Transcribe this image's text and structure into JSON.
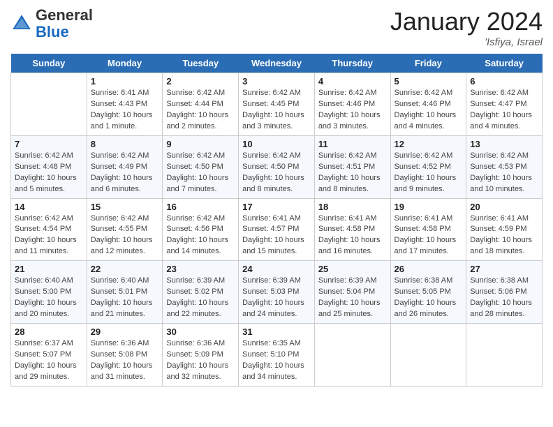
{
  "header": {
    "logo_general": "General",
    "logo_blue": "Blue",
    "month_title": "January 2024",
    "location": "'Isfiya, Israel"
  },
  "days_of_week": [
    "Sunday",
    "Monday",
    "Tuesday",
    "Wednesday",
    "Thursday",
    "Friday",
    "Saturday"
  ],
  "weeks": [
    [
      {
        "date": "",
        "sunrise": "",
        "sunset": "",
        "daylight": ""
      },
      {
        "date": "1",
        "sunrise": "Sunrise: 6:41 AM",
        "sunset": "Sunset: 4:43 PM",
        "daylight": "Daylight: 10 hours and 1 minute."
      },
      {
        "date": "2",
        "sunrise": "Sunrise: 6:42 AM",
        "sunset": "Sunset: 4:44 PM",
        "daylight": "Daylight: 10 hours and 2 minutes."
      },
      {
        "date": "3",
        "sunrise": "Sunrise: 6:42 AM",
        "sunset": "Sunset: 4:45 PM",
        "daylight": "Daylight: 10 hours and 3 minutes."
      },
      {
        "date": "4",
        "sunrise": "Sunrise: 6:42 AM",
        "sunset": "Sunset: 4:46 PM",
        "daylight": "Daylight: 10 hours and 3 minutes."
      },
      {
        "date": "5",
        "sunrise": "Sunrise: 6:42 AM",
        "sunset": "Sunset: 4:46 PM",
        "daylight": "Daylight: 10 hours and 4 minutes."
      },
      {
        "date": "6",
        "sunrise": "Sunrise: 6:42 AM",
        "sunset": "Sunset: 4:47 PM",
        "daylight": "Daylight: 10 hours and 4 minutes."
      }
    ],
    [
      {
        "date": "7",
        "sunrise": "Sunrise: 6:42 AM",
        "sunset": "Sunset: 4:48 PM",
        "daylight": "Daylight: 10 hours and 5 minutes."
      },
      {
        "date": "8",
        "sunrise": "Sunrise: 6:42 AM",
        "sunset": "Sunset: 4:49 PM",
        "daylight": "Daylight: 10 hours and 6 minutes."
      },
      {
        "date": "9",
        "sunrise": "Sunrise: 6:42 AM",
        "sunset": "Sunset: 4:50 PM",
        "daylight": "Daylight: 10 hours and 7 minutes."
      },
      {
        "date": "10",
        "sunrise": "Sunrise: 6:42 AM",
        "sunset": "Sunset: 4:50 PM",
        "daylight": "Daylight: 10 hours and 8 minutes."
      },
      {
        "date": "11",
        "sunrise": "Sunrise: 6:42 AM",
        "sunset": "Sunset: 4:51 PM",
        "daylight": "Daylight: 10 hours and 8 minutes."
      },
      {
        "date": "12",
        "sunrise": "Sunrise: 6:42 AM",
        "sunset": "Sunset: 4:52 PM",
        "daylight": "Daylight: 10 hours and 9 minutes."
      },
      {
        "date": "13",
        "sunrise": "Sunrise: 6:42 AM",
        "sunset": "Sunset: 4:53 PM",
        "daylight": "Daylight: 10 hours and 10 minutes."
      }
    ],
    [
      {
        "date": "14",
        "sunrise": "Sunrise: 6:42 AM",
        "sunset": "Sunset: 4:54 PM",
        "daylight": "Daylight: 10 hours and 11 minutes."
      },
      {
        "date": "15",
        "sunrise": "Sunrise: 6:42 AM",
        "sunset": "Sunset: 4:55 PM",
        "daylight": "Daylight: 10 hours and 12 minutes."
      },
      {
        "date": "16",
        "sunrise": "Sunrise: 6:42 AM",
        "sunset": "Sunset: 4:56 PM",
        "daylight": "Daylight: 10 hours and 14 minutes."
      },
      {
        "date": "17",
        "sunrise": "Sunrise: 6:41 AM",
        "sunset": "Sunset: 4:57 PM",
        "daylight": "Daylight: 10 hours and 15 minutes."
      },
      {
        "date": "18",
        "sunrise": "Sunrise: 6:41 AM",
        "sunset": "Sunset: 4:58 PM",
        "daylight": "Daylight: 10 hours and 16 minutes."
      },
      {
        "date": "19",
        "sunrise": "Sunrise: 6:41 AM",
        "sunset": "Sunset: 4:58 PM",
        "daylight": "Daylight: 10 hours and 17 minutes."
      },
      {
        "date": "20",
        "sunrise": "Sunrise: 6:41 AM",
        "sunset": "Sunset: 4:59 PM",
        "daylight": "Daylight: 10 hours and 18 minutes."
      }
    ],
    [
      {
        "date": "21",
        "sunrise": "Sunrise: 6:40 AM",
        "sunset": "Sunset: 5:00 PM",
        "daylight": "Daylight: 10 hours and 20 minutes."
      },
      {
        "date": "22",
        "sunrise": "Sunrise: 6:40 AM",
        "sunset": "Sunset: 5:01 PM",
        "daylight": "Daylight: 10 hours and 21 minutes."
      },
      {
        "date": "23",
        "sunrise": "Sunrise: 6:39 AM",
        "sunset": "Sunset: 5:02 PM",
        "daylight": "Daylight: 10 hours and 22 minutes."
      },
      {
        "date": "24",
        "sunrise": "Sunrise: 6:39 AM",
        "sunset": "Sunset: 5:03 PM",
        "daylight": "Daylight: 10 hours and 24 minutes."
      },
      {
        "date": "25",
        "sunrise": "Sunrise: 6:39 AM",
        "sunset": "Sunset: 5:04 PM",
        "daylight": "Daylight: 10 hours and 25 minutes."
      },
      {
        "date": "26",
        "sunrise": "Sunrise: 6:38 AM",
        "sunset": "Sunset: 5:05 PM",
        "daylight": "Daylight: 10 hours and 26 minutes."
      },
      {
        "date": "27",
        "sunrise": "Sunrise: 6:38 AM",
        "sunset": "Sunset: 5:06 PM",
        "daylight": "Daylight: 10 hours and 28 minutes."
      }
    ],
    [
      {
        "date": "28",
        "sunrise": "Sunrise: 6:37 AM",
        "sunset": "Sunset: 5:07 PM",
        "daylight": "Daylight: 10 hours and 29 minutes."
      },
      {
        "date": "29",
        "sunrise": "Sunrise: 6:36 AM",
        "sunset": "Sunset: 5:08 PM",
        "daylight": "Daylight: 10 hours and 31 minutes."
      },
      {
        "date": "30",
        "sunrise": "Sunrise: 6:36 AM",
        "sunset": "Sunset: 5:09 PM",
        "daylight": "Daylight: 10 hours and 32 minutes."
      },
      {
        "date": "31",
        "sunrise": "Sunrise: 6:35 AM",
        "sunset": "Sunset: 5:10 PM",
        "daylight": "Daylight: 10 hours and 34 minutes."
      },
      {
        "date": "",
        "sunrise": "",
        "sunset": "",
        "daylight": ""
      },
      {
        "date": "",
        "sunrise": "",
        "sunset": "",
        "daylight": ""
      },
      {
        "date": "",
        "sunrise": "",
        "sunset": "",
        "daylight": ""
      }
    ]
  ]
}
